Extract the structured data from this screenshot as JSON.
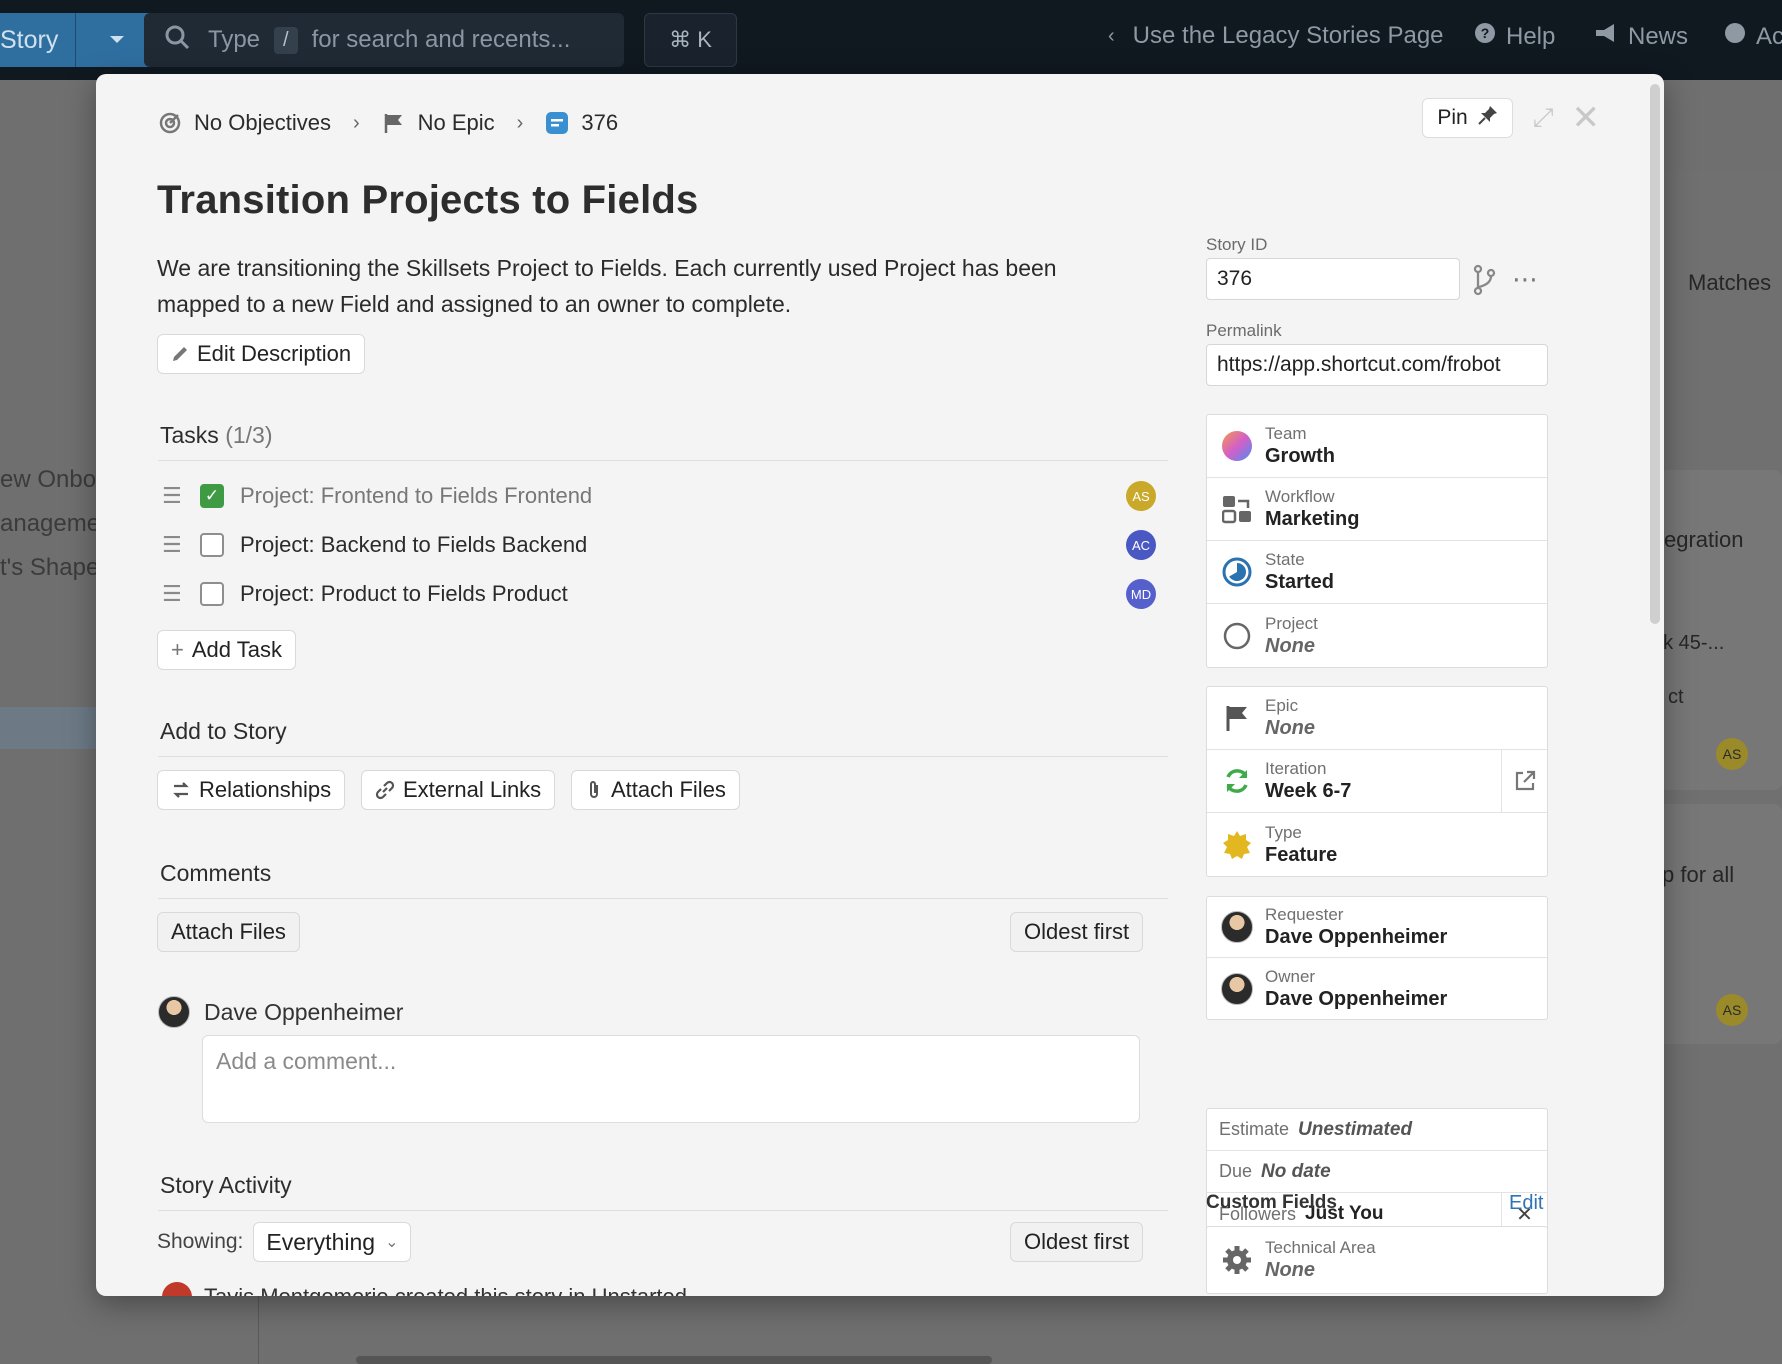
{
  "background": {
    "story_button_label": "Story",
    "search": {
      "type_word": "Type",
      "slash": "/",
      "hint": "for search and recents..."
    },
    "command_k": "⌘ K",
    "nav": {
      "legacy": "Use the Legacy Stories Page",
      "help": "Help",
      "news": "News",
      "account": "Ac"
    },
    "sidebar_items": [
      "ew Onbo",
      "anageme",
      "t's Shape"
    ],
    "right_texts": {
      "matches": "Matches",
      "integration": "egration",
      "week": "ek 45-...",
      "ct": "ct",
      "for_all": "p for all",
      "avatar": "AS"
    }
  },
  "breadcrumb": {
    "objectives": "No Objectives",
    "epic": "No Epic",
    "story_id": "376"
  },
  "top_actions": {
    "pin_label": "Pin"
  },
  "story": {
    "title": "Transition Projects to Fields",
    "description": "We are transitioning the Skillsets Project to Fields. Each currently used Project has been mapped to a new Field and assigned to an owner to complete.",
    "edit_description_label": "Edit Description"
  },
  "tasks": {
    "title": "Tasks",
    "count": "(1/3)",
    "items": [
      {
        "label": "Project: Frontend to Fields Frontend",
        "done": true,
        "owner": "AS",
        "color": "#c9a82a"
      },
      {
        "label": "Project: Backend to Fields Backend",
        "done": false,
        "owner": "AC",
        "color": "#4a58c4"
      },
      {
        "label": "Project: Product to Fields Product",
        "done": false,
        "owner": "MD",
        "color": "#5560cc"
      }
    ],
    "add_label": "Add Task"
  },
  "add_to_story": {
    "title": "Add to Story",
    "relationships": "Relationships",
    "external_links": "External Links",
    "attach_files": "Attach Files"
  },
  "comments": {
    "title": "Comments",
    "attach_files": "Attach Files",
    "sort": "Oldest first",
    "user": "Dave Oppenheimer",
    "placeholder": "Add a comment..."
  },
  "activity": {
    "title": "Story Activity",
    "showing_label": "Showing:",
    "filter": "Everything",
    "sort": "Oldest first",
    "peek_text": "Tavis Montgomerie created this story in Unstarted"
  },
  "sidebar": {
    "story_id_label": "Story ID",
    "story_id_value": "376",
    "permalink_label": "Permalink",
    "permalink_value": "https://app.shortcut.com/frobot",
    "team": {
      "label": "Team",
      "value": "Growth"
    },
    "workflow": {
      "label": "Workflow",
      "value": "Marketing"
    },
    "state": {
      "label": "State",
      "value": "Started"
    },
    "project": {
      "label": "Project",
      "value": "None"
    },
    "epic": {
      "label": "Epic",
      "value": "None"
    },
    "iteration": {
      "label": "Iteration",
      "value": "Week 6-7"
    },
    "type": {
      "label": "Type",
      "value": "Feature"
    },
    "requester": {
      "label": "Requester",
      "value": "Dave Oppenheimer"
    },
    "owner": {
      "label": "Owner",
      "value": "Dave Oppenheimer"
    },
    "estimate": {
      "label": "Estimate",
      "value": "Unestimated"
    },
    "due": {
      "label": "Due",
      "value": "No date"
    },
    "followers": {
      "label": "Followers",
      "value": "Just You"
    },
    "custom_fields_title": "Custom Fields",
    "custom_fields_edit": "Edit",
    "technical_area": {
      "label": "Technical Area",
      "value": "None"
    }
  },
  "colors": {
    "accent": "#2f74b5",
    "done_green": "#3f9a44",
    "topbar": "#101820"
  }
}
